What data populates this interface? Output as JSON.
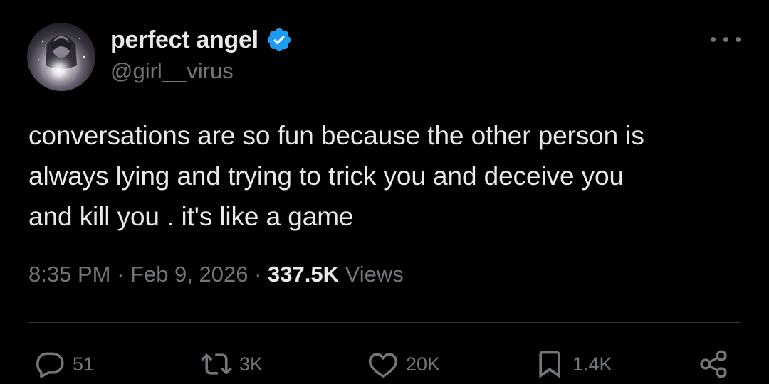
{
  "author": {
    "display_name": "perfect angel",
    "handle": "@girl__virus",
    "verified": true,
    "verified_color": "#1d9bf0",
    "avatar_icon": "avatar-image"
  },
  "tweet": {
    "text": "conversations are so fun because the other person is\nalways lying and trying to trick you and deceive you\nand kill you . it's like a game",
    "time": "8:35 PM",
    "separator": " · ",
    "date": "Feb 9, 2026",
    "views_count": "337.5K",
    "views_label": "Views"
  },
  "actions": {
    "replies": {
      "icon": "reply-icon",
      "count": "51"
    },
    "reposts": {
      "icon": "repost-icon",
      "count": "3K"
    },
    "likes": {
      "icon": "heart-icon",
      "count": "20K"
    },
    "bookmarks": {
      "icon": "bookmark-icon",
      "count": "1.4K"
    },
    "share": {
      "icon": "share-icon"
    }
  },
  "colors": {
    "background": "#000000",
    "primary_text": "#e7e9ea",
    "secondary_text": "#71767b",
    "divider": "#2f3336"
  }
}
